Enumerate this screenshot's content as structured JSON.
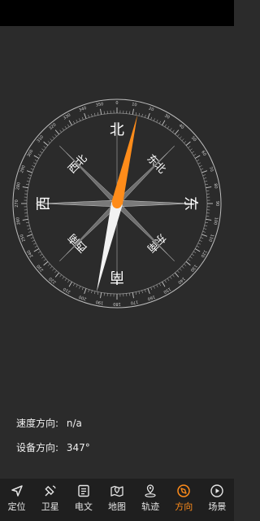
{
  "compass": {
    "directions": {
      "north": "北",
      "south": "南",
      "east": "东",
      "west": "西",
      "northeast": "东北",
      "northwest": "西北",
      "southeast": "东南",
      "southwest": "西南"
    },
    "heading_degrees": 347,
    "accent_color": "#ff8c1a"
  },
  "info": {
    "speed_label": "速度方向:",
    "speed_value": "n/a",
    "device_label": "设备方向:",
    "device_value": "347°"
  },
  "nav": {
    "active_index": 6,
    "items": [
      {
        "label": "定位",
        "icon": "navigation-arrow-icon"
      },
      {
        "label": "卫星",
        "icon": "satellite-icon"
      },
      {
        "label": "电文",
        "icon": "document-list-icon"
      },
      {
        "label": "地图",
        "icon": "map-pin-icon"
      },
      {
        "label": "轨迹",
        "icon": "track-pin-icon"
      },
      {
        "label": "方向",
        "icon": "compass-icon"
      },
      {
        "label": "场景",
        "icon": "play-circle-icon"
      }
    ]
  }
}
